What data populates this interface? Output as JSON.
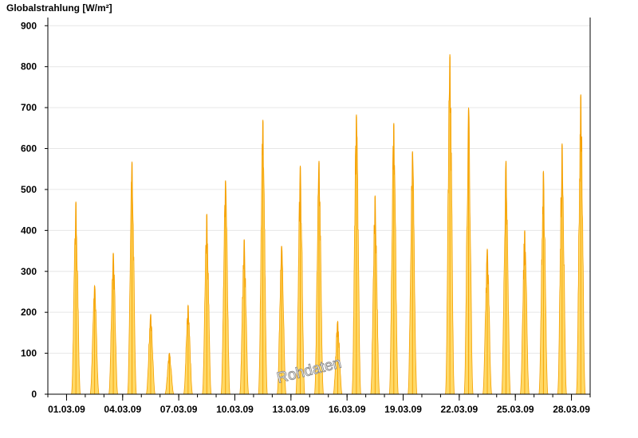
{
  "chart_data": {
    "type": "area",
    "title": "Globalstrahlung [W/m²]",
    "xlabel": "",
    "ylabel": "",
    "watermark": "Rohdaten",
    "ylim": [
      0,
      920
    ],
    "xlim": [
      "2009-02-28",
      "2009-03-29"
    ],
    "yticks": [
      0,
      100,
      200,
      300,
      400,
      500,
      600,
      700,
      800,
      900
    ],
    "xticks": [
      {
        "date": "2009-03-01",
        "label": "01.03.09"
      },
      {
        "date": "2009-03-04",
        "label": "04.03.09"
      },
      {
        "date": "2009-03-07",
        "label": "07.03.09"
      },
      {
        "date": "2009-03-10",
        "label": "10.03.09"
      },
      {
        "date": "2009-03-13",
        "label": "13.03.09"
      },
      {
        "date": "2009-03-16",
        "label": "16.03.09"
      },
      {
        "date": "2009-03-19",
        "label": "19.03.09"
      },
      {
        "date": "2009-03-22",
        "label": "22.03.09"
      },
      {
        "date": "2009-03-25",
        "label": "25.03.09"
      },
      {
        "date": "2009-03-28",
        "label": "28.03.09"
      }
    ],
    "grid": true,
    "fill_color": "#ffd966",
    "line_color": "#f5a000",
    "series": [
      {
        "daily_peaks": [
          {
            "date": "2009-03-01",
            "peak": 470
          },
          {
            "date": "2009-03-02",
            "peak": 265
          },
          {
            "date": "2009-03-03",
            "peak": 345
          },
          {
            "date": "2009-03-04",
            "peak": 568
          },
          {
            "date": "2009-03-05",
            "peak": 195
          },
          {
            "date": "2009-03-06",
            "peak": 100
          },
          {
            "date": "2009-03-07",
            "peak": 217
          },
          {
            "date": "2009-03-08",
            "peak": 440
          },
          {
            "date": "2009-03-09",
            "peak": 522
          },
          {
            "date": "2009-03-10",
            "peak": 378
          },
          {
            "date": "2009-03-11",
            "peak": 670
          },
          {
            "date": "2009-03-12",
            "peak": 362
          },
          {
            "date": "2009-03-13",
            "peak": 558
          },
          {
            "date": "2009-03-14",
            "peak": 570
          },
          {
            "date": "2009-03-15",
            "peak": 178
          },
          {
            "date": "2009-03-16",
            "peak": 683
          },
          {
            "date": "2009-03-17",
            "peak": 485
          },
          {
            "date": "2009-03-18",
            "peak": 662
          },
          {
            "date": "2009-03-19",
            "peak": 593
          },
          {
            "date": "2009-03-20",
            "peak": 0
          },
          {
            "date": "2009-03-21",
            "peak": 830
          },
          {
            "date": "2009-03-22",
            "peak": 700
          },
          {
            "date": "2009-03-23",
            "peak": 355
          },
          {
            "date": "2009-03-24",
            "peak": 570
          },
          {
            "date": "2009-03-25",
            "peak": 400
          },
          {
            "date": "2009-03-26",
            "peak": 545
          },
          {
            "date": "2009-03-27",
            "peak": 612
          },
          {
            "date": "2009-03-28",
            "peak": 732
          }
        ]
      }
    ]
  }
}
